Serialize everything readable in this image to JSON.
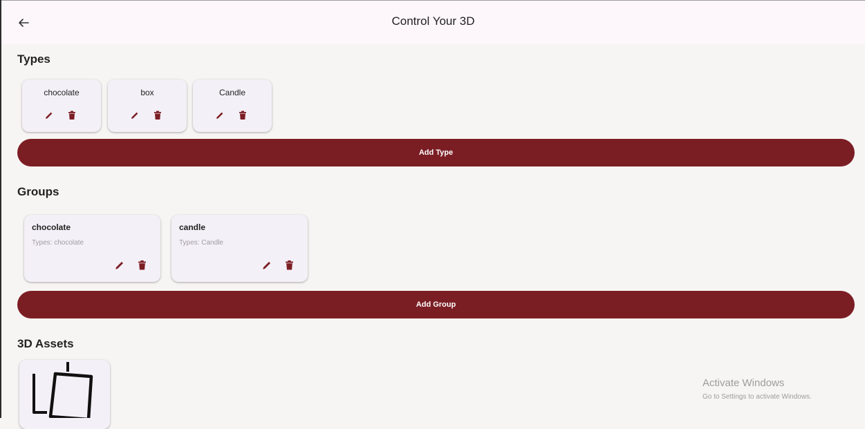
{
  "appbar": {
    "title": "Control Your 3D",
    "back_icon": "arrow-left-icon"
  },
  "types": {
    "title": "Types",
    "items": [
      {
        "name": "chocolate"
      },
      {
        "name": "box"
      },
      {
        "name": "Candle"
      }
    ],
    "add_label": "Add Type"
  },
  "groups": {
    "title": "Groups",
    "items": [
      {
        "name": "chocolate",
        "types": "Types: chocolate"
      },
      {
        "name": "candle",
        "types": "Types: Candle"
      }
    ],
    "add_label": "Add Group"
  },
  "assets": {
    "title": "3D Assets"
  },
  "watermark": {
    "title": "Activate Windows",
    "subtitle": "Go to Settings to activate Windows."
  },
  "colors": {
    "accent": "#7b1e24",
    "background": "#f7f5f3",
    "card": "#f4f0f7",
    "appbar": "#fdf7fb"
  }
}
